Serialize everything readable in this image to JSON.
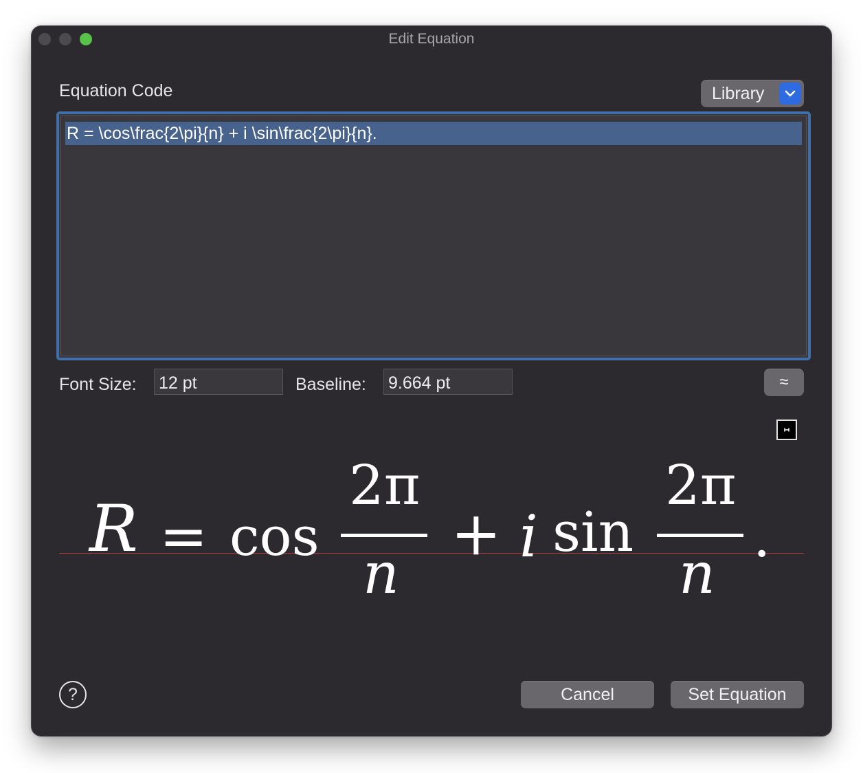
{
  "window": {
    "title": "Edit Equation"
  },
  "editor": {
    "section_label": "Equation Code",
    "library_label": "Library",
    "code": "R = \\cos\\frac{2\\pi}{n} + i \\sin\\frac{2\\pi}{n}."
  },
  "settings": {
    "font_size_label": "Font Size:",
    "font_size_value": "12 pt",
    "baseline_label": "Baseline:",
    "baseline_value": "9.664 pt",
    "approx_label": "≈"
  },
  "preview": {
    "R": "R",
    "equals": "=",
    "cos": "cos",
    "num1": "2π",
    "den1": "n",
    "plus": "+",
    "i": "i",
    "sin": "sin",
    "num2": "2π",
    "den2": "n",
    "period": ".",
    "baseline_color": "#b23a3a"
  },
  "footer": {
    "help_label": "?",
    "cancel_label": "Cancel",
    "set_label": "Set Equation"
  },
  "colors": {
    "window_bg": "#2d2a2f",
    "accent": "#2f6be0",
    "focus_ring": "#3f6ea8",
    "selection": "#47628c",
    "zoom_button": "#58c24a"
  }
}
